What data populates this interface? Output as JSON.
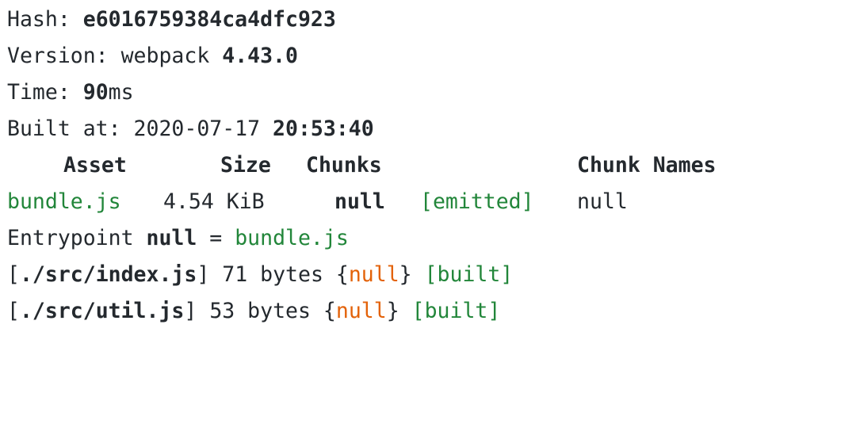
{
  "colors": {
    "text": "#24292e",
    "green": "#22863a",
    "orange": "#e36209",
    "background": "#ffffff"
  },
  "summary": {
    "hash_label": "Hash: ",
    "hash_value": "e6016759384ca4dfc923",
    "version_label": "Version: webpack ",
    "version_value": "4.43.0",
    "time_label": "Time: ",
    "time_value": "90",
    "time_unit": "ms",
    "built_label": "Built at: 2020-07-17 ",
    "built_time": "20:53:40"
  },
  "asset_table": {
    "headers": {
      "asset": "Asset",
      "size": "Size",
      "chunks": "Chunks",
      "chunk_names": "Chunk Names"
    },
    "rows": [
      {
        "asset": "bundle.js",
        "size": "4.54 KiB",
        "chunks": "null",
        "status": "[emitted]",
        "chunk_names": "null"
      }
    ]
  },
  "entrypoint": {
    "label": "Entrypoint ",
    "name": "null",
    "equals": " = ",
    "file": "bundle.js"
  },
  "modules": [
    {
      "open": "[",
      "path": "./src/index.js",
      "close": "]",
      "size": " 71 bytes ",
      "brace_open": "{",
      "chunk": "null",
      "brace_close": "} ",
      "status": "[built]"
    },
    {
      "open": "[",
      "path": "./src/util.js",
      "close": "]",
      "size": " 53 bytes ",
      "brace_open": "{",
      "chunk": "null",
      "brace_close": "} ",
      "status": "[built]"
    }
  ]
}
